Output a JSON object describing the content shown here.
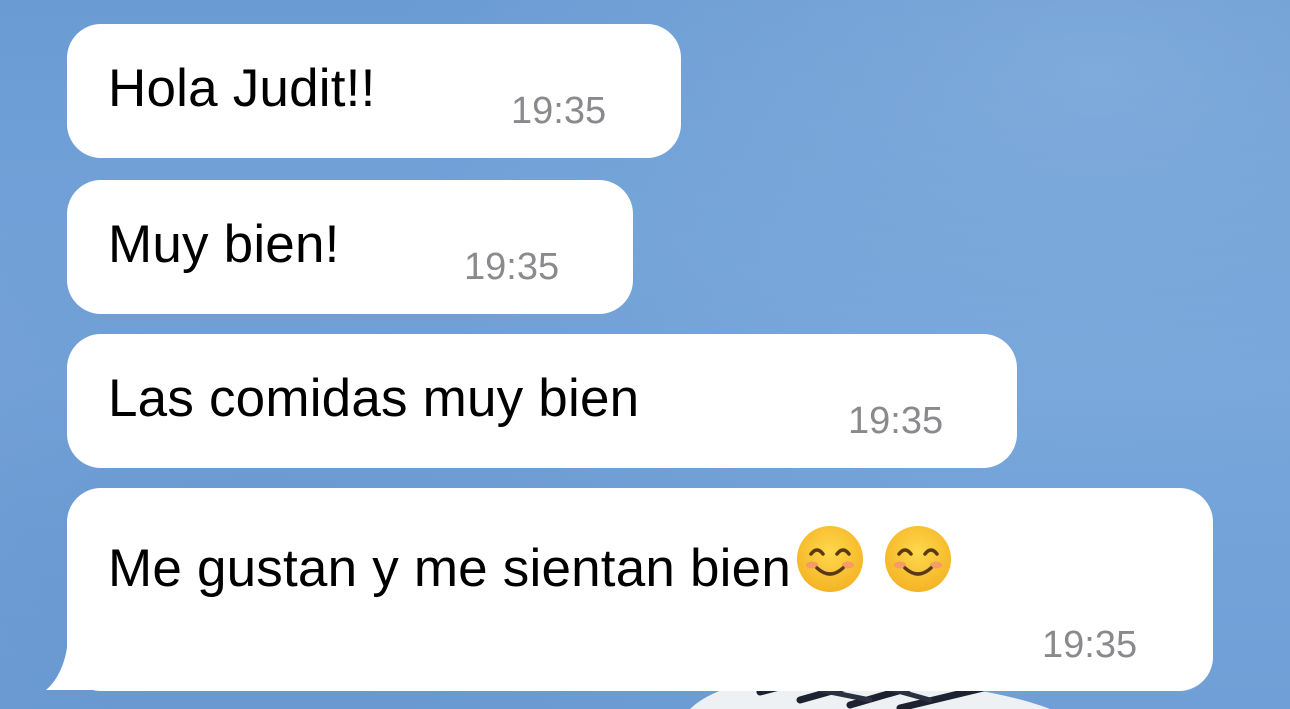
{
  "chat": {
    "messages": [
      {
        "text": "Hola Judit!!",
        "time": "19:35"
      },
      {
        "text": "Muy bien!",
        "time": "19:35"
      },
      {
        "text": "Las comidas muy bien",
        "time": "19:35"
      },
      {
        "text": "Me gustan y me sientan bien",
        "emojis": [
          "smiling-face-with-smiling-eyes",
          "smiling-face-with-smiling-eyes"
        ],
        "time": "19:35"
      }
    ]
  },
  "colors": {
    "background": "#6d9fd6",
    "bubble": "#ffffff",
    "text": "#000000",
    "timestamp": "#8a8a8e",
    "emoji": "#f7c531"
  }
}
